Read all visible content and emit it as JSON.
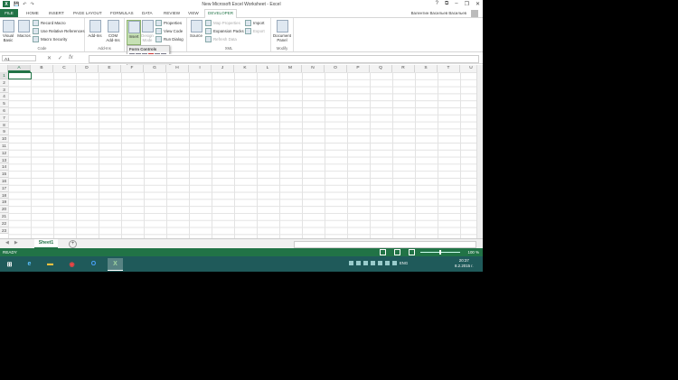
{
  "window": {
    "title": "New Microsoft Excel Worksheet - Excel",
    "controls": [
      "?",
      "⧉",
      "–",
      "❐",
      "✕"
    ]
  },
  "qat": {
    "logo": "X",
    "save": "💾",
    "undo": "↶",
    "redo": "↷"
  },
  "tabs": [
    {
      "label": "FILE",
      "left": 0
    },
    {
      "label": "HOME"
    },
    {
      "label": "INSERT"
    },
    {
      "label": "PAGE LAYOUT"
    },
    {
      "label": "FORMULAS"
    },
    {
      "label": "DATA"
    },
    {
      "label": "REVIEW"
    },
    {
      "label": "VIEW"
    },
    {
      "label": "DEVELOPER"
    }
  ],
  "user": "Валентин Васильев Васильев",
  "ribbon": {
    "code": {
      "visual_basic": "Visual Basic",
      "macros": "Macros",
      "record_macro": "Record Macro",
      "relative_refs": "Use Relative References",
      "macro_security": "Macro Security",
      "label": "Code"
    },
    "addins": {
      "add_ins": "Add-Ins",
      "com_add_ins": "COM Add-Ins",
      "label": "Add-Ins"
    },
    "controls": {
      "insert": "Insert",
      "design_mode": "Design Mode",
      "properties": "Properties",
      "view_code": "View Code",
      "run_dialog": "Run Dialog",
      "label": "Controls"
    },
    "xml": {
      "source": "Source",
      "map_properties": "Map Properties",
      "expansion_packs": "Expansion Packs",
      "refresh_data": "Refresh Data",
      "import": "Import",
      "export": "Export",
      "label": "XML"
    },
    "modify": {
      "document_panel": "Document Panel",
      "label": "Modify"
    }
  },
  "insert_popup": {
    "form_controls": "Form Controls",
    "activex_controls": "ActiveX Controls"
  },
  "formula_bar": {
    "name_box": "A1",
    "cancel": "✕",
    "enter": "✓",
    "fx": "fx"
  },
  "columns": [
    "A",
    "B",
    "C",
    "D",
    "E",
    "F",
    "G",
    "H",
    "I",
    "J",
    "K",
    "L",
    "M",
    "N",
    "O",
    "P",
    "Q",
    "R",
    "S",
    "T",
    "U"
  ],
  "rows": [
    "1",
    "2",
    "3",
    "4",
    "5",
    "6",
    "7",
    "8",
    "9",
    "10",
    "11",
    "12",
    "13",
    "14",
    "15",
    "16",
    "17",
    "18",
    "19",
    "20",
    "21",
    "22",
    "23"
  ],
  "sheet": {
    "tab": "Sheet1",
    "add": "+",
    "nav_prev": "◀",
    "nav_next": "▶"
  },
  "status": {
    "ready": "READY",
    "zoom": "100 %"
  },
  "taskbar": {
    "start": "⊞",
    "ie": "e",
    "explorer": "▬",
    "chrome": "◉",
    "outlook": "O",
    "excel": "X",
    "lang": "ENG",
    "time": "20:37",
    "date": "8.2.2015 г."
  }
}
